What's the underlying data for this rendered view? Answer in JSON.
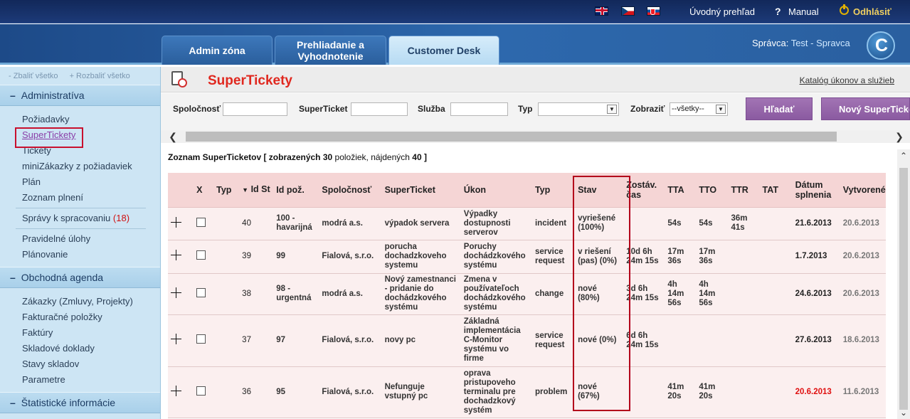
{
  "topbar": {
    "overview_label": "Úvodný prehľad",
    "manual_label": "Manual",
    "logout_label": "Odhlásiť",
    "help_glyph": "?",
    "languages": [
      "en",
      "cz",
      "sk"
    ]
  },
  "header": {
    "tabs": [
      {
        "label": "Admin zóna"
      },
      {
        "label": "Prehliadanie a Vyhodnotenie"
      },
      {
        "label": "Customer Desk"
      }
    ],
    "manager_prefix": "Správca:",
    "manager_name": "Test - Spravca"
  },
  "sidebar": {
    "collapse_all": "Zbaliť všetko",
    "expand_all": "Rozbaliť všetko",
    "sections": [
      {
        "title": "Administratíva",
        "items": [
          "Požiadavky",
          "SuperTickety",
          "Tickety",
          "miniZákazky z požiadaviek",
          "Plán",
          "Zoznam plnení"
        ],
        "items2_label": "Správy k spracovaniu",
        "items2_count": "(18)",
        "items3": [
          "Pravidelné úlohy",
          "Plánovanie"
        ]
      },
      {
        "title": "Obchodná agenda",
        "items": [
          "Zákazky (Zmluvy, Projekty)",
          "Fakturačné položky",
          "Faktúry",
          "Skladové doklady",
          "Stavy skladov",
          "Parametre"
        ]
      },
      {
        "title": "Štatistické informácie"
      }
    ],
    "active_item": "SuperTickety"
  },
  "main": {
    "title": "SuperTickety",
    "catalog_link": "Katalóg úkonov a služieb",
    "filters": {
      "company_label": "Spoločnosť",
      "superticket_label": "SuperTicket",
      "service_label": "Služba",
      "type_label": "Typ",
      "show_label": "Zobraziť",
      "show_value": "--všetky--",
      "type_value": ""
    },
    "search_button": "Hľadať",
    "new_button": "Nový SuperTicket",
    "list_caption_prefix": "Zoznam SuperTicketov [ zobrazených ",
    "list_shown": "30",
    "list_caption_mid": " položiek, nájdených ",
    "list_found": "40",
    "list_caption_suffix": " ]"
  },
  "table": {
    "headers": [
      "",
      "X",
      "Typ",
      "Id St",
      "Id pož.",
      "Spoločnosť",
      "SuperTicket",
      "Úkon",
      "Typ",
      "Stav",
      "Zostáv. čas",
      "TTA",
      "TTO",
      "TTR",
      "TAT",
      "Dátum splnenia",
      "Vytvorené"
    ],
    "rows": [
      {
        "id": "40",
        "req": "100 - havarijná",
        "company": "modrá a.s.",
        "ticket": "výpadok servera",
        "action": "Výpadky dostupnosti serverov",
        "type": "incident",
        "state": "vyriešené (100%)",
        "remaining": "",
        "tta": "54s",
        "tto": "54s",
        "ttr": "36m 41s",
        "tat": "",
        "due": "21.6.2013",
        "due_overdue": false,
        "created": "20.6.2013"
      },
      {
        "id": "39",
        "req": "99",
        "company": "Fialová, s.r.o.",
        "ticket": "porucha dochadzkoveho systemu",
        "action": "Poruchy dochádzkového systému",
        "type": "service request",
        "state": "v riešení (pas) (0%)",
        "remaining": "10d 6h 24m 15s",
        "tta": "17m 36s",
        "tto": "17m 36s",
        "ttr": "",
        "tat": "",
        "due": "1.7.2013",
        "due_overdue": false,
        "created": "20.6.2013"
      },
      {
        "id": "38",
        "req": "98 - urgentná",
        "company": "modrá a.s.",
        "ticket": "Nový zamestnanci - pridanie do dochádzkového systému",
        "action": "Zmena v používateľoch dochádzkového systému",
        "type": "change",
        "state": "nové (80%)",
        "remaining": "3d 6h 24m 15s",
        "tta": "4h 14m 56s",
        "tto": "4h 14m 56s",
        "ttr": "",
        "tat": "",
        "due": "24.6.2013",
        "due_overdue": false,
        "created": "20.6.2013"
      },
      {
        "id": "37",
        "req": "97",
        "company": "Fialová, s.r.o.",
        "ticket": "novy pc",
        "action": "Základná implementácia C-Monitor systému vo firme",
        "type": "service request",
        "state": "nové (0%)",
        "remaining": "6d 6h 24m 15s",
        "tta": "",
        "tto": "",
        "ttr": "",
        "tat": "",
        "due": "27.6.2013",
        "due_overdue": false,
        "created": "18.6.2013"
      },
      {
        "id": "36",
        "req": "95",
        "company": "Fialová, s.r.o.",
        "ticket": "Nefunguje vstupný pc",
        "action": "oprava pristupoveho terminalu pre dochadzkový systém",
        "type": "problem",
        "state": "nové (67%)",
        "remaining": "",
        "tta": "41m 20s",
        "tto": "41m 20s",
        "ttr": "",
        "tat": "",
        "due": "20.6.2013",
        "due_overdue": true,
        "created": "11.6.2013"
      }
    ]
  },
  "colors": {
    "title_red": "#e0281f",
    "overdue_red": "#e01010",
    "button_purple": "#8a5aa0",
    "header_bg": "#f5d5d5",
    "row_bg": "#fbefef"
  }
}
